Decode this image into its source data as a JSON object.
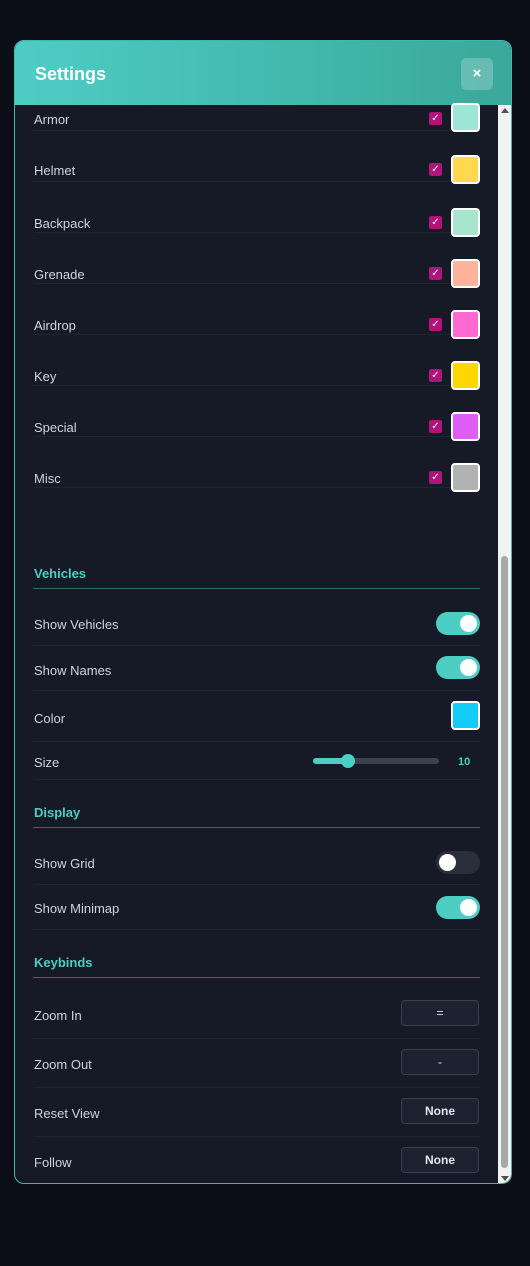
{
  "header": {
    "title": "Settings",
    "close_label": "×"
  },
  "items": [
    {
      "label": "Armor",
      "checked": true,
      "color": "#9de6d6"
    },
    {
      "label": "Helmet",
      "checked": true,
      "color": "#ffd84f"
    },
    {
      "label": "Backpack",
      "checked": true,
      "color": "#a7e6cd"
    },
    {
      "label": "Grenade",
      "checked": true,
      "color": "#ffb39b"
    },
    {
      "label": "Airdrop",
      "checked": true,
      "color": "#ff6ad2"
    },
    {
      "label": "Key",
      "checked": true,
      "color": "#ffd700"
    },
    {
      "label": "Special",
      "checked": true,
      "color": "#df5cf5"
    },
    {
      "label": "Misc",
      "checked": true,
      "color": "#b2b2b2"
    }
  ],
  "vehicles": {
    "title": "Vehicles",
    "show_vehicles": {
      "label": "Show Vehicles",
      "on": true
    },
    "show_names": {
      "label": "Show Names",
      "on": true
    },
    "color": {
      "label": "Color",
      "value": "#14ccf5"
    },
    "size": {
      "label": "Size",
      "value": "10",
      "fraction": 0.25
    }
  },
  "display": {
    "title": "Display",
    "show_grid": {
      "label": "Show Grid",
      "on": false
    },
    "show_minimap": {
      "label": "Show Minimap",
      "on": true
    }
  },
  "keybinds": {
    "title": "Keybinds",
    "zoom_in": {
      "label": "Zoom In",
      "key": "="
    },
    "zoom_out": {
      "label": "Zoom Out",
      "key": "-"
    },
    "reset_view": {
      "label": "Reset View",
      "key": "None"
    },
    "follow": {
      "label": "Follow",
      "key": "None"
    }
  },
  "colors": {
    "accent": "#4ecdc4",
    "checkbox": "#b0137a"
  }
}
